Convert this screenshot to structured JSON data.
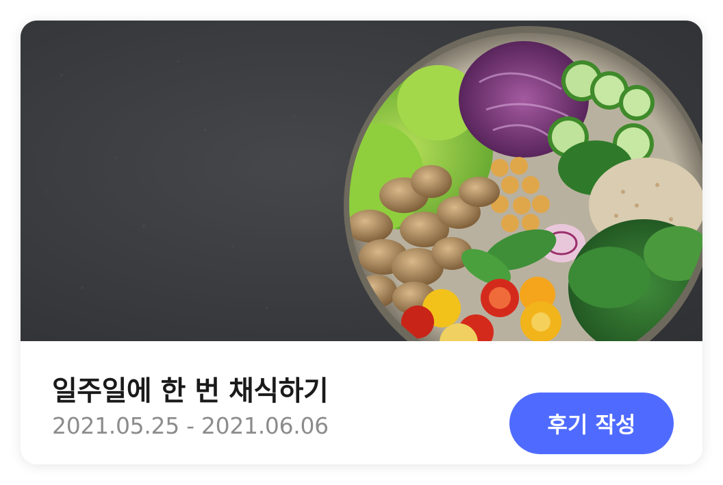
{
  "challenge": {
    "title": "일주일에 한 번 채식하기",
    "period": "2021.05.25 - 2021.06.06",
    "review_button_label": "후기 작성",
    "image_alt": "salad-bowl-photo"
  },
  "colors": {
    "accent": "#4f6bff",
    "title_text": "#1a1a1a",
    "period_text": "#8c8c8c",
    "photo_background": "#3b3d40"
  }
}
